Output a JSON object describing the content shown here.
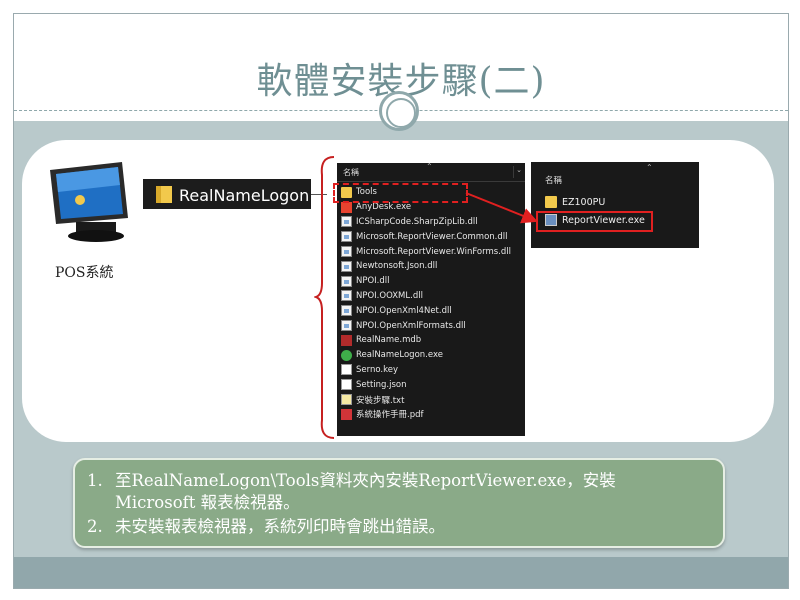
{
  "slide": {
    "title": "軟體安裝步驟(二)"
  },
  "pos": {
    "label": "POS系統",
    "icon": "pos-terminal-icon"
  },
  "folder_label": "RealNameLogon",
  "explorer": {
    "header": "名稱",
    "items": [
      {
        "name": "Tools",
        "icon": "folder"
      },
      {
        "name": "AnyDesk.exe",
        "icon": "anydesk"
      },
      {
        "name": "ICSharpCode.SharpZipLib.dll",
        "icon": "dll"
      },
      {
        "name": "Microsoft.ReportViewer.Common.dll",
        "icon": "dll"
      },
      {
        "name": "Microsoft.ReportViewer.WinForms.dll",
        "icon": "dll"
      },
      {
        "name": "Newtonsoft.Json.dll",
        "icon": "dll"
      },
      {
        "name": "NPOI.dll",
        "icon": "dll"
      },
      {
        "name": "NPOI.OOXML.dll",
        "icon": "dll"
      },
      {
        "name": "NPOI.OpenXml4Net.dll",
        "icon": "dll"
      },
      {
        "name": "NPOI.OpenXmlFormats.dll",
        "icon": "dll"
      },
      {
        "name": "RealName.mdb",
        "icon": "mdb"
      },
      {
        "name": "RealNameLogon.exe",
        "icon": "exe"
      },
      {
        "name": "Serno.key",
        "icon": "file"
      },
      {
        "name": "Setting.json",
        "icon": "file"
      },
      {
        "name": "安裝步驟.txt",
        "icon": "txt"
      },
      {
        "name": "系統操作手冊.pdf",
        "icon": "pdf"
      }
    ]
  },
  "tools_folder": {
    "header": "名稱",
    "items": [
      {
        "name": "EZ100PU",
        "icon": "folder"
      },
      {
        "name": "ReportViewer.exe",
        "icon": "rv"
      }
    ]
  },
  "notes": {
    "n1_num": "1.",
    "n1_line1": "至RealNameLogon\\Tools資料夾內安裝ReportViewer.exe，安裝",
    "n1_line2": "Microsoft 報表檢視器。",
    "n2_num": "2.",
    "n2_text": "未安裝報表檢視器，系統列印時會跳出錯誤。"
  },
  "colors": {
    "title": "#6f8f93",
    "highlight": "#e02020",
    "note_bg": "#8aaa88"
  }
}
